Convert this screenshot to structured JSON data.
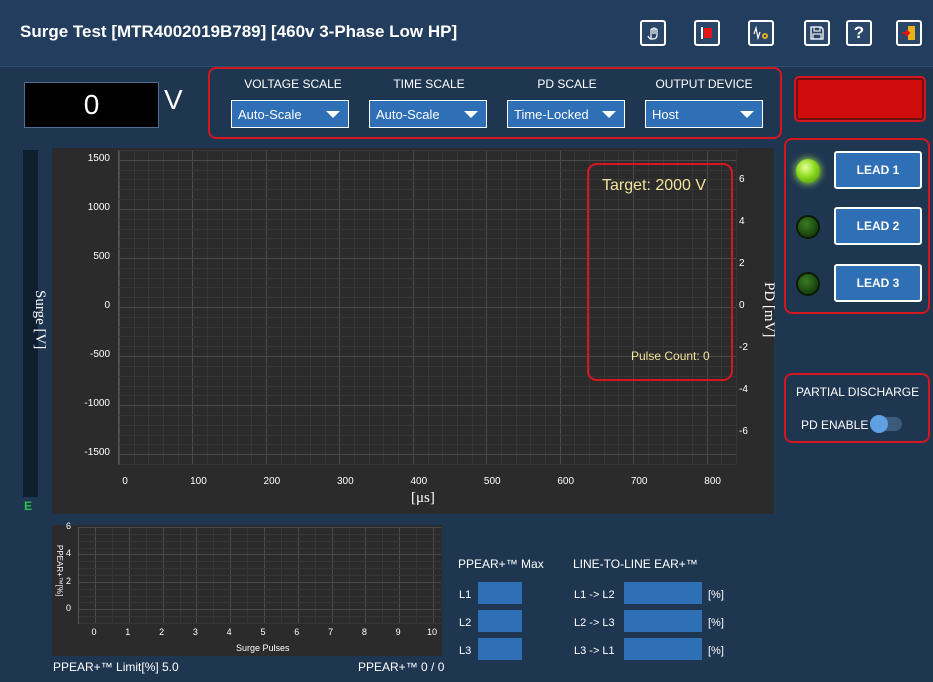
{
  "header": {
    "title": "Surge Test [MTR4002019B789] [460v 3-Phase Low HP]",
    "icons": [
      "hand-wave-icon",
      "bookmark-icon",
      "settings-wave-icon",
      "save-icon",
      "help-icon",
      "exit-icon"
    ],
    "help_glyph": "?"
  },
  "voltage": {
    "value": "0",
    "unit": "V"
  },
  "scales": [
    {
      "label": "VOLTAGE SCALE",
      "value": "Auto-Scale"
    },
    {
      "label": "TIME SCALE",
      "value": "Auto-Scale"
    },
    {
      "label": "PD SCALE",
      "value": "Time-Locked"
    },
    {
      "label": "OUTPUT DEVICE",
      "value": "Host"
    }
  ],
  "leads": [
    {
      "label": "LEAD 1",
      "state": "on"
    },
    {
      "label": "LEAD 2",
      "state": "off"
    },
    {
      "label": "LEAD 3",
      "state": "off"
    }
  ],
  "partial_discharge": {
    "title": "PARTIAL DISCHARGE",
    "enable_label": "PD ENABLE",
    "enabled": false
  },
  "side_indicator": "E",
  "main_chart": {
    "target": "Target: 2000 V",
    "pulse_count": "Pulse Count: 0",
    "ylabel": "Surge [V]",
    "ylabel_right": "PD [mV]",
    "xlabel": "[μs]",
    "y_ticks": [
      "1500",
      "1000",
      "500",
      "0",
      "-500",
      "-1000",
      "-1500"
    ],
    "y_right_ticks": [
      "6",
      "4",
      "2",
      "0",
      "-2",
      "-4",
      "-6"
    ],
    "x_ticks": [
      "0",
      "100",
      "200",
      "300",
      "400",
      "500",
      "600",
      "700",
      "800"
    ]
  },
  "chart_data": [
    {
      "type": "line",
      "series": [],
      "xlabel": "[μs]",
      "ylabel": "Surge [V]",
      "y2label": "PD [mV]",
      "xlim": [
        0,
        840
      ],
      "ylim": [
        -1600,
        1600
      ],
      "y2lim": [
        -7.5,
        7.5
      ],
      "grid": true
    },
    {
      "type": "line",
      "series": [],
      "xlabel": "Surge Pulses",
      "ylabel": "PPEAR+™[%]",
      "xlim": [
        0,
        10
      ],
      "ylim": [
        -1,
        6
      ],
      "grid": true
    }
  ],
  "ppear_chart": {
    "ylabel": "PPEAR+™[%]",
    "xlabel": "Surge Pulses",
    "y_ticks": [
      "6",
      "4",
      "2",
      "0"
    ],
    "x_ticks": [
      "0",
      "1",
      "2",
      "3",
      "4",
      "5",
      "6",
      "7",
      "8",
      "9",
      "10"
    ],
    "limit_label": "PPEAR+™ Limit[%] 5.0",
    "count_label": "PPEAR+™  0 / 0"
  },
  "ppear_max": {
    "title": "PPEAR+™ Max",
    "rows": [
      "L1",
      "L2",
      "L3"
    ]
  },
  "line_to_line": {
    "title": "LINE-TO-LINE EAR+™",
    "rows": [
      {
        "label": "L1 -> L2",
        "unit": "[%]"
      },
      {
        "label": "L2 -> L3",
        "unit": "[%]"
      },
      {
        "label": "L3 -> L1",
        "unit": "[%]"
      }
    ]
  }
}
